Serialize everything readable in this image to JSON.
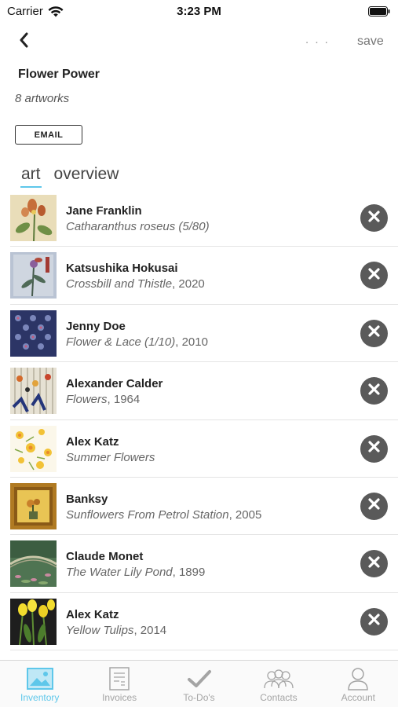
{
  "status_bar": {
    "carrier": "Carrier",
    "time": "3:23 PM"
  },
  "nav": {
    "more_label": ". . .",
    "save_label": "save"
  },
  "collection": {
    "title": "Flower Power",
    "count_label": "8 artworks",
    "email_label": "EMAIL"
  },
  "tabs": [
    {
      "label": "art",
      "active": true
    },
    {
      "label": "overview",
      "active": false
    }
  ],
  "artworks": [
    {
      "artist": "Jane Franklin",
      "title": "Catharanthus roseus (5/80)",
      "year": ""
    },
    {
      "artist": "Katsushika Hokusai",
      "title": "Crossbill and Thistle",
      "year": ", 2020"
    },
    {
      "artist": "Jenny Doe",
      "title": "Flower & Lace (1/10)",
      "year": ", 2010"
    },
    {
      "artist": "Alexander Calder",
      "title": "Flowers",
      "year": ", 1964"
    },
    {
      "artist": "Alex Katz",
      "title": "Summer Flowers",
      "year": ""
    },
    {
      "artist": "Banksy",
      "title": "Sunflowers From Petrol Station",
      "year": ", 2005"
    },
    {
      "artist": "Claude Monet",
      "title": "The Water Lily Pond",
      "year": ", 1899"
    },
    {
      "artist": "Alex Katz",
      "title": "Yellow Tulips",
      "year": ", 2014"
    }
  ],
  "tab_bar": [
    {
      "label": "Inventory",
      "icon": "image-icon",
      "active": true
    },
    {
      "label": "Invoices",
      "icon": "invoice-icon",
      "active": false
    },
    {
      "label": "To-Do's",
      "icon": "checkmark-icon",
      "active": false
    },
    {
      "label": "Contacts",
      "icon": "contacts-icon",
      "active": false
    },
    {
      "label": "Account",
      "icon": "user-icon",
      "active": false
    }
  ],
  "colors": {
    "accent": "#5ec7ea",
    "remove_button": "#5a5a5a",
    "inactive_tab": "#a4a4a4"
  }
}
